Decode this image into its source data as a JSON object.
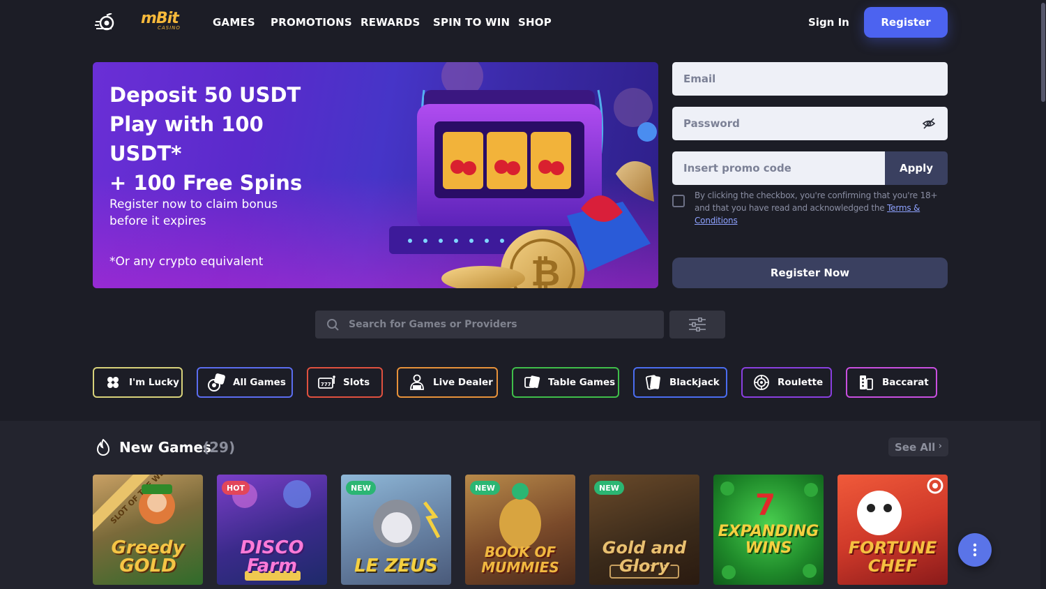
{
  "nav": {
    "logo_text": "mBit",
    "logo_sub": "CASINO",
    "links": [
      "GAMES",
      "PROMOTIONS",
      "REWARDS",
      "SPIN TO WIN",
      "SHOP"
    ],
    "signin": "Sign In",
    "register": "Register"
  },
  "hero": {
    "title_line1": "Deposit 50 USDT",
    "title_line2": "Play with 100 USDT*",
    "title_line3": "+ 100 Free Spins",
    "subtitle": "Register now to claim bonus before it expires",
    "note": "*Or any crypto equivalent"
  },
  "form": {
    "email_placeholder": "Email",
    "password_placeholder": "Password",
    "promo_placeholder": "Insert promo code",
    "apply": "Apply",
    "consent_text": "By clicking the checkbox, you're confirming that you're 18+ and that you have read and acknowledged the ",
    "terms_link": "Terms & Conditions",
    "register_now": "Register Now"
  },
  "search": {
    "placeholder": "Search for Games or Providers"
  },
  "categories": [
    {
      "label": "I'm Lucky",
      "color": "#d8d27a",
      "icon": "clover-icon"
    },
    {
      "label": "All Games",
      "color": "#5b6df0",
      "icon": "dice-icon"
    },
    {
      "label": "Slots",
      "color": "#e0513f",
      "icon": "slot-machine-icon"
    },
    {
      "label": "Live Dealer",
      "color": "#e8923a",
      "icon": "live-dealer-icon"
    },
    {
      "label": "Table Games",
      "color": "#3fbf4a",
      "icon": "table-games-icon"
    },
    {
      "label": "Blackjack",
      "color": "#4b6df0",
      "icon": "cards-icon"
    },
    {
      "label": "Roulette",
      "color": "#8a3fe0",
      "icon": "roulette-icon"
    },
    {
      "label": "Baccarat",
      "color": "#c94fe0",
      "icon": "baccarat-icon"
    }
  ],
  "new_games": {
    "title": "New Games",
    "count": "(29)",
    "see_all": "See All",
    "games": [
      {
        "name": "Greedy GOLD",
        "badge": "",
        "ribbon": "SLOT OF THE WEEK"
      },
      {
        "name": "DISCO Farm",
        "badge": "HOT"
      },
      {
        "name": "LE ZEUS",
        "badge": "NEW"
      },
      {
        "name": "BOOK OF MUMMIES",
        "badge": "NEW"
      },
      {
        "name": "Gold and Glory",
        "badge": "NEW"
      },
      {
        "name": "EXPANDING WINS",
        "badge": ""
      },
      {
        "name": "FORTUNE CHEF",
        "badge": ""
      }
    ]
  },
  "colors": {
    "bg": "#1c1d26",
    "accent": "#4c63f0",
    "hot_badge": "#e2465a",
    "new_badge": "#2bb673"
  }
}
